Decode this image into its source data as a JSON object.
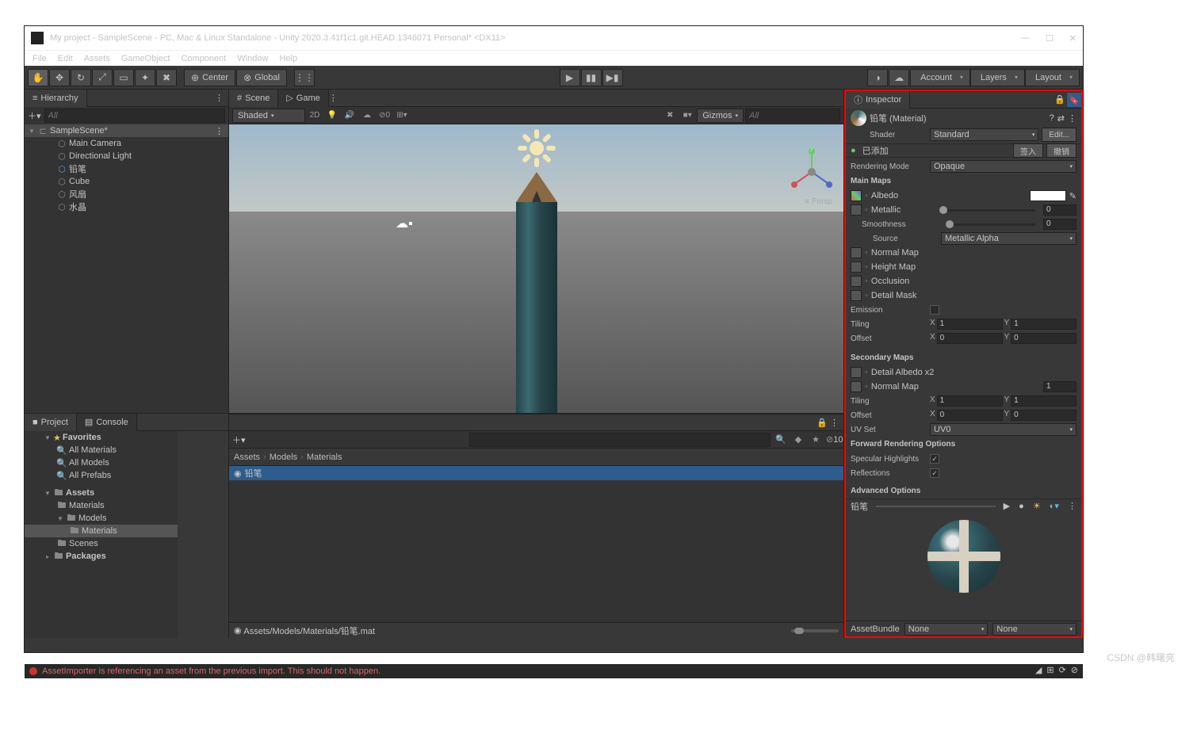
{
  "window": {
    "title": "My project - SampleScene - PC, Mac & Linux Standalone - Unity 2020.3.41f1c1.git.HEAD.1346071 Personal* <DX11>"
  },
  "menu": [
    "File",
    "Edit",
    "Assets",
    "GameObject",
    "Component",
    "Window",
    "Help"
  ],
  "toolbar": {
    "center": "Center",
    "global": "Global",
    "account": "Account",
    "layers": "Layers",
    "layout": "Layout"
  },
  "hierarchy": {
    "title": "Hierarchy",
    "search_ph": "All",
    "scene": "SampleScene*",
    "items": [
      {
        "label": "Main Camera",
        "dim": false
      },
      {
        "label": "Directional Light",
        "dim": false
      },
      {
        "label": "铅笔",
        "sel": true
      },
      {
        "label": "Cube",
        "dim": true
      },
      {
        "label": "风扇",
        "dim": false
      },
      {
        "label": "水晶",
        "dim": true
      }
    ]
  },
  "scene": {
    "tab_scene": "Scene",
    "tab_game": "Game",
    "shaded": "Shaded",
    "twod": "2D",
    "gizmos": "Gizmos",
    "search_ph": "All",
    "persp": "≡ Persp"
  },
  "project": {
    "tab_project": "Project",
    "tab_console": "Console",
    "hidden_count": "10",
    "favorites": "Favorites",
    "fav_items": [
      "All Materials",
      "All Models",
      "All Prefabs"
    ],
    "assets": "Assets",
    "assets_items": [
      "Materials",
      "Models",
      "Materials",
      "Scenes"
    ],
    "packages": "Packages",
    "crumbs": [
      "Assets",
      "Models",
      "Materials"
    ],
    "file": "铅笔",
    "path": "Assets/Models/Materials/铅笔.mat"
  },
  "inspector": {
    "title": "Inspector",
    "mat_name": "铅笔 (Material)",
    "shader_lbl": "Shader",
    "shader_val": "Standard",
    "edit": "Edit...",
    "added": "已添加",
    "checkin": "签入",
    "revert": "撤销",
    "render_lbl": "Rendering Mode",
    "render_val": "Opaque",
    "main_maps": "Main Maps",
    "albedo": "Albedo",
    "metallic": "Metallic",
    "metallic_v": "0",
    "smooth": "Smoothness",
    "smooth_v": "0",
    "source": "Source",
    "source_v": "Metallic Alpha",
    "normal": "Normal Map",
    "height": "Height Map",
    "occl": "Occlusion",
    "detailmask": "Detail Mask",
    "emission": "Emission",
    "tiling": "Tiling",
    "tiling_x": "1",
    "tiling_y": "1",
    "offset": "Offset",
    "offset_x": "0",
    "offset_y": "0",
    "secondary": "Secondary Maps",
    "detail_albedo": "Detail Albedo x2",
    "normal2": "Normal Map",
    "normal2_v": "1",
    "tiling2_x": "1",
    "tiling2_y": "1",
    "offset2_x": "0",
    "offset2_y": "0",
    "uvset": "UV Set",
    "uvset_v": "UV0",
    "fwd": "Forward Rendering Options",
    "spec": "Specular Highlights",
    "refl": "Reflections",
    "adv": "Advanced Options",
    "preview_name": "铅笔",
    "ab": "AssetBundle",
    "ab_v": "None",
    "ab_v2": "None"
  },
  "status": {
    "msg": "AssetImporter is referencing an asset from the previous import. This should not happen."
  },
  "watermark": "CSDN @韩曙亮"
}
